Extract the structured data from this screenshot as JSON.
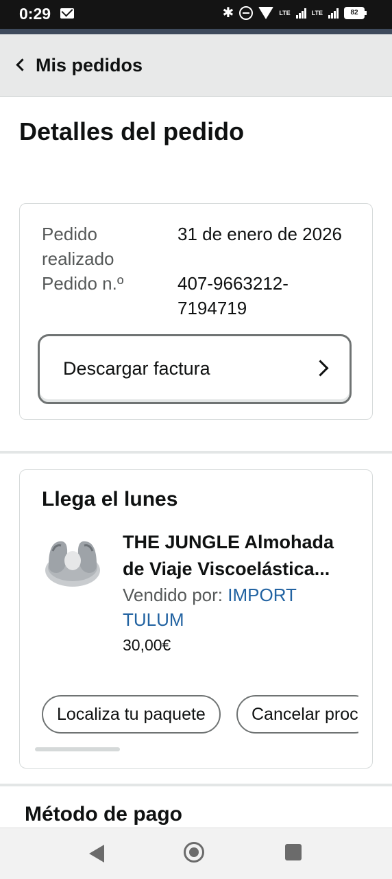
{
  "status_bar": {
    "time": "0:29",
    "lte_1": "LTE",
    "lte_2": "LTE",
    "battery": "82"
  },
  "header": {
    "back_label": "Mis pedidos"
  },
  "page_title": "Detalles del pedido",
  "order_summary": {
    "placed_label": "Pedido realizado",
    "placed_value": "31 de enero de 2026",
    "number_label": "Pedido n.º",
    "number_value": "407-9663212-7194719",
    "invoice_button": "Descargar factura"
  },
  "shipment": {
    "heading": "Llega el lunes",
    "product_title": "THE JUNGLE Almohada de Viaje Viscoelástica...",
    "seller_prefix": "Vendido por:",
    "seller_name": "IMPORT TULUM",
    "price": "30,00€",
    "actions": [
      "Localiza tu paquete",
      "Cancelar proc"
    ]
  },
  "payment": {
    "heading": "Método de pago"
  },
  "icons": [
    "mail-icon",
    "bluetooth-icon",
    "dnd-icon",
    "wifi-icon",
    "signal-icon",
    "battery-icon",
    "chevron-left-icon",
    "chevron-right-icon",
    "product-thumbnail",
    "nav-back-icon",
    "nav-home-icon",
    "nav-recents-icon"
  ],
  "colors": {
    "link": "#2162a1",
    "status_bar": "#141414",
    "header_bg": "#e8e9e9"
  }
}
